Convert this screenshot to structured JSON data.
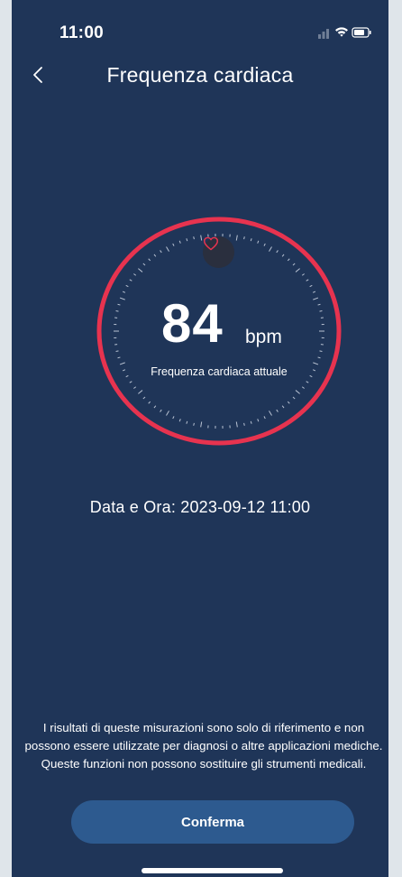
{
  "status_bar": {
    "time": "11:00",
    "icons": [
      "signal-icon",
      "wifi-icon",
      "battery-icon"
    ]
  },
  "nav": {
    "back_icon": "chevron-left-icon",
    "title": "Frequenza cardiaca"
  },
  "heart_rate": {
    "value": "84",
    "unit": "bpm",
    "caption": "Frequenza cardiaca attuale",
    "icon": "heart-icon"
  },
  "measurement": {
    "label": "Data e Ora: ",
    "datetime": "2023-09-12 11:00"
  },
  "disclaimer": "I risultati di queste misurazioni sono solo di riferimento e non possono essere utilizzate per diagnosi o altre applicazioni mediche. Queste funzioni non possono sostituire gli strumenti medicali.",
  "buttons": {
    "confirm": "Conferma"
  },
  "colors": {
    "background": "#1f3558",
    "ring": "#e7334f",
    "button": "#2d5a8f",
    "text": "#ffffff"
  }
}
